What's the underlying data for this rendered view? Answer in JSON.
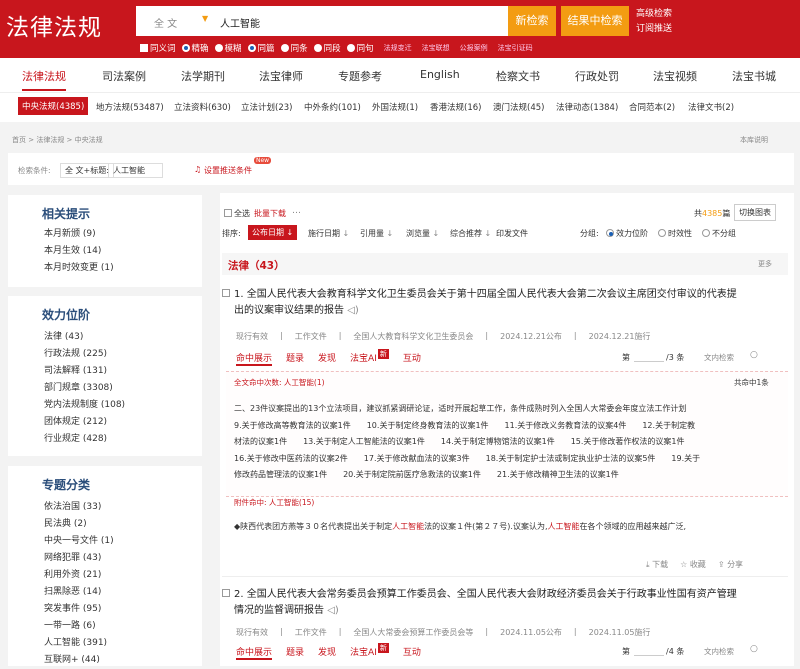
{
  "header": {
    "logo": "法律法规",
    "scope": "全 文",
    "query": "人工智能",
    "btn_search": "新检索",
    "btn_within": "结果中检索",
    "link_advanced": "高级检索",
    "link_subscribe": "订阅推送",
    "opt_synonym": "同义词",
    "opt_exact": "精确",
    "opt_fuzzy": "模糊",
    "opt_same_article": "同篇",
    "opt_same_clause": "同条",
    "opt_same_para": "同段",
    "opt_same_sentence": "同句",
    "mini1": "法规变迁",
    "mini2": "法宝联想",
    "mini3": "公报案例",
    "mini4": "法宝引证码"
  },
  "nav": [
    "法律法规",
    "司法案例",
    "法学期刊",
    "法宝律师",
    "专题参考",
    "English",
    "检察文书",
    "行政处罚",
    "法宝视频",
    "法宝书城"
  ],
  "subnav": [
    "中央法规(4385)",
    "地方法规(53487)",
    "立法资料(630)",
    "立法计划(23)",
    "中外条约(101)",
    "外国法规(1)",
    "香港法规(16)",
    "澳门法规(45)",
    "法律动态(1384)",
    "合同范本(2)",
    "法律文书(2)"
  ],
  "breadcrumb": "首页 > 法律法规 > 中央法规",
  "help": "本库说明",
  "filter": {
    "label": "检索条件:",
    "cond1": "全 文+标题:",
    "cond2": "人工智能",
    "subscribe": "设置推送条件",
    "new_badge": "New"
  },
  "panels": {
    "related_title": "相关提示",
    "related": [
      "本月新颁 (9)",
      "本月生效 (14)",
      "本月时效变更 (1)"
    ],
    "level_title": "效力位阶",
    "level": [
      "法律 (43)",
      "行政法规 (225)",
      "司法解释 (131)",
      "部门规章 (3308)",
      "党内法规制度 (108)",
      "团体规定 (212)",
      "行业规定 (428)"
    ],
    "topic_title": "专题分类",
    "topic": [
      "依法治国 (33)",
      "民法典 (2)",
      "中央一号文件 (1)",
      "网络犯罪 (43)",
      "利用外资 (21)",
      "扫黑除恶 (14)",
      "突发事件 (95)",
      "一带一路 (6)",
      "人工智能 (391)",
      "互联网+ (44)"
    ]
  },
  "toolbar": {
    "select_all": "全选",
    "batch_download": "批量下载",
    "more": "…",
    "total_prefix": "共",
    "total_count": "4385",
    "total_suffix": "篇",
    "switch_chart": "切换图表",
    "sort_label": "排序:",
    "sort_items": [
      "公布日期",
      "施行日期",
      "引用量",
      "浏览量",
      "综合推荐",
      "印发文件"
    ],
    "group_label": "分组:",
    "group_items": [
      "效力位阶",
      "时效性",
      "不分组"
    ]
  },
  "section": {
    "title": "法律（43）",
    "more": "更多"
  },
  "results": [
    {
      "title_line1": "1. 全国人民代表大会教育科学文化卫生委员会关于第十四届全国人民代表大会第二次会议主席团交付审议的代表提",
      "title_line2": "出的议案审议结果的报告",
      "status": "现行有效",
      "type": "工作文件",
      "issuer": "全国人大教育科学文化卫生委员会",
      "published": "2024.12.21公布",
      "effective": "2024.12.21施行",
      "tabs": [
        "命中展示",
        "题录",
        "发现",
        "法宝AI",
        "互动"
      ],
      "ai_tag": "新",
      "page_label": "第",
      "page_total": "/3 条",
      "search_in": "文内检索",
      "hit_label": "全文命中次数:",
      "hit_term": "人工智能(1)",
      "hit_total": "共命中1条",
      "body": [
        "二、23件议案提出的13个立法项目，建议抓紧调研论证，适时开展起草工作，条件成熟时列入全国人大常委会年度立法工作计划",
        "9.关于修改高等教育法的议案1件　　10.关于制定终身教育法的议案1件　　11.关于修改义务教育法的议案4件　　12.关于制定教",
        "材法的议案1件　　13.关于制定人工智能法的议案1件　　14.关于制定博物馆法的议案1件　　15.关于修改著作权法的议案1件",
        "16.关于修改中医药法的议案2件　　17.关于修改献血法的议案3件　　18.关于制定护士法或制定执业护士法的议案5件　　19.关于",
        "修改药品管理法的议案1件　　20.关于制定院前医疗急救法的议案1件　　21.关于修改精神卫生法的议案1件"
      ],
      "attach_label": "附件命中:",
      "attach_term": "人工智能(15)",
      "attach_text_a": "◆陕西代表团方燕等３０名代表提出关于制定",
      "attach_text_hl": "人工智能",
      "attach_text_b": "法的议案１件(第２７号).议案认为,",
      "attach_text_hl2": "人工智能",
      "attach_text_c": "在各个领域的应用越来越广泛,",
      "download": "下载",
      "favorite": "收藏",
      "share": "分享"
    },
    {
      "title_line1": "2. 全国人民代表大会常务委员会预算工作委员会、全国人民代表大会财政经济委员会关于行政事业性国有资产管理",
      "title_line2": "情况的监督调研报告",
      "status": "现行有效",
      "type": "工作文件",
      "issuer": "全国人大常委会预算工作委员会等",
      "published": "2024.11.05公布",
      "effective": "2024.11.05施行",
      "tabs": [
        "命中展示",
        "题录",
        "发现",
        "法宝AI",
        "互动"
      ],
      "ai_tag": "新",
      "page_label": "第",
      "page_total": "/4 条",
      "search_in": "文内检索"
    }
  ]
}
